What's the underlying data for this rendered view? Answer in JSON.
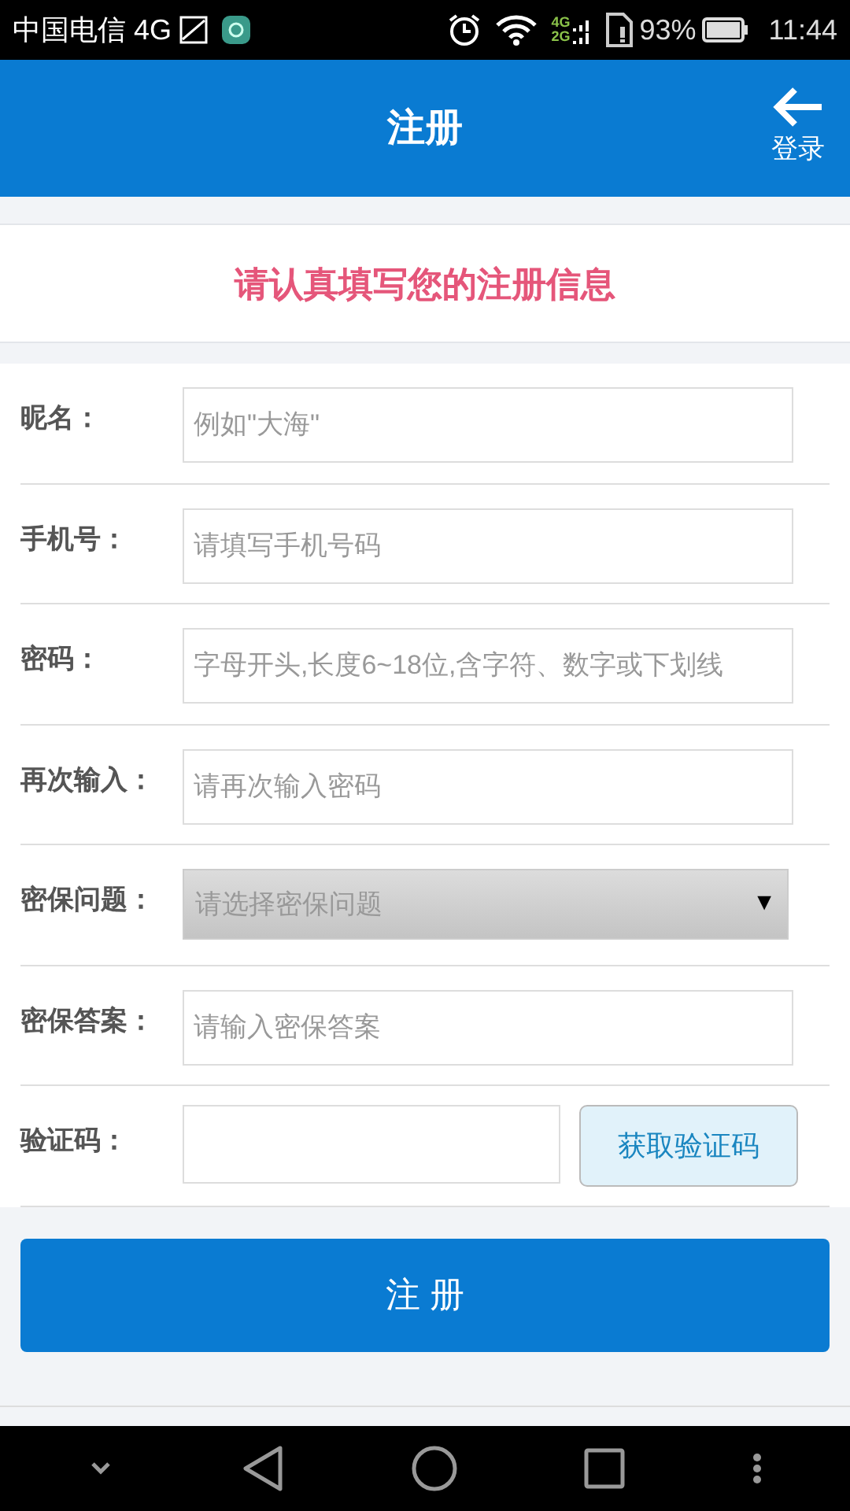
{
  "status_bar": {
    "carrier": "中国电信 4G",
    "network_labels": [
      "4G",
      "2G"
    ],
    "battery": "93%",
    "time": "11:44"
  },
  "header": {
    "title": "注册",
    "back_label": "登录"
  },
  "notice": "请认真填写您的注册信息",
  "fields": [
    {
      "kind": "text",
      "label": "昵名：",
      "placeholder": "例如\"大海\""
    },
    {
      "kind": "text",
      "label": "手机号：",
      "placeholder": "请填写手机号码"
    },
    {
      "kind": "text",
      "label": "密码：",
      "placeholder": "字母开头,长度6~18位,含字符、数字或下划线"
    },
    {
      "kind": "text",
      "label": "再次输入：",
      "placeholder": "请再次输入密码"
    },
    {
      "kind": "select",
      "label": "密保问题：",
      "placeholder": "请选择密保问题",
      "arrow": "▼"
    },
    {
      "kind": "text",
      "label": "密保答案：",
      "placeholder": "请输入密保答案"
    },
    {
      "kind": "code",
      "label": "验证码：",
      "button": "获取验证码"
    }
  ],
  "submit": "注 册"
}
